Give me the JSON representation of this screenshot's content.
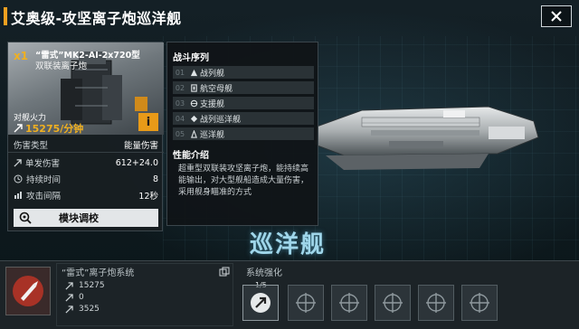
{
  "header": {
    "title": "艾奥级-攻坚离子炮巡洋舰",
    "close_icon": "close-icon"
  },
  "weapon": {
    "count": "x1",
    "name": "“雷式”MK2-AI-2x720型",
    "type": "双联装离子炮",
    "firepower_label": "对舰火力",
    "firepower_value": "15275/分钟",
    "info_label": "i",
    "stats": {
      "damage_type_label": "伤害类型",
      "damage_type_value": "能量伤害",
      "single_damage_label": "单发伤害",
      "single_damage_value": "612+24.0",
      "duration_label": "持续时间",
      "duration_value": "8",
      "interval_label": "攻击间隔",
      "interval_value": "12秒"
    },
    "tune_button_label": "模块调校"
  },
  "info_panel": {
    "sequence_heading": "战斗序列",
    "sequence": [
      {
        "num": "01",
        "label": "战列舰"
      },
      {
        "num": "02",
        "label": "航空母舰"
      },
      {
        "num": "03",
        "label": "支援舰"
      },
      {
        "num": "04",
        "label": "战列巡洋舰"
      },
      {
        "num": "05",
        "label": "巡洋舰"
      }
    ],
    "perf_heading": "性能介绍",
    "perf_text": "超重型双联装攻坚离子炮，能持续高能输出，对大型舰船造成大量伤害，采用舰身瞄准的方式"
  },
  "ship_class": "巡洋舰",
  "bottom": {
    "module_title": "“雷式”离子炮系统",
    "module_stats": [
      {
        "value": "15275"
      },
      {
        "value": "0"
      },
      {
        "value": "3525"
      }
    ],
    "enhance_title": "系统强化",
    "slot_counter": "1/5"
  },
  "colors": {
    "accent": "#f0a020",
    "ship_label": "#9fd6ea"
  }
}
